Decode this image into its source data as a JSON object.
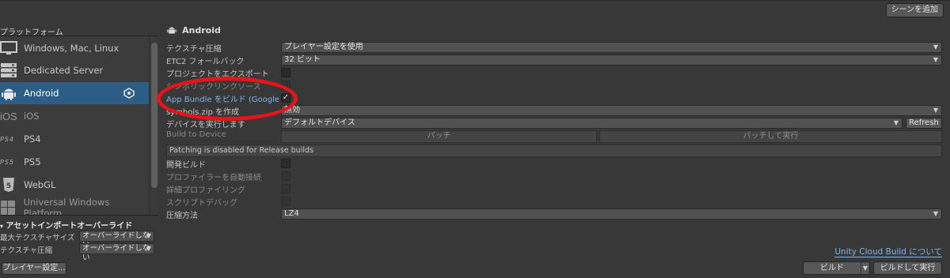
{
  "topbar": {
    "add_scene_label": "シーンを追加"
  },
  "platforms": {
    "header": "プラットフォーム",
    "items": [
      {
        "label": "Windows, Mac, Linux",
        "icon": "monitor-icon",
        "selected": false,
        "dim": false
      },
      {
        "label": "Dedicated Server",
        "icon": "server-icon",
        "selected": false,
        "dim": false
      },
      {
        "label": "Android",
        "icon": "android-icon",
        "selected": true,
        "dim": false
      },
      {
        "label": "iOS",
        "icon": "ios-icon",
        "selected": false,
        "dim": true
      },
      {
        "label": "PS4",
        "icon": "ps4-icon",
        "selected": false,
        "dim": false
      },
      {
        "label": "PS5",
        "icon": "ps5-icon",
        "selected": false,
        "dim": false
      },
      {
        "label": "WebGL",
        "icon": "html5-icon",
        "selected": false,
        "dim": false
      },
      {
        "label": "Universal Windows Platform",
        "icon": "windows-icon",
        "selected": false,
        "dim": true
      }
    ]
  },
  "asset_import": {
    "header": "アセットインポートオーバーライド",
    "rows": [
      {
        "label": "最大テクスチャサイズ",
        "value": "オーバーライドしない"
      },
      {
        "label": "テクスチャ圧縮",
        "value": "オーバーライドしない"
      }
    ]
  },
  "player_settings_label": "プレイヤー設定...",
  "android": {
    "title": "Android",
    "texture_compression": {
      "label": "テクスチャ圧縮",
      "value": "プレイヤー設定を使用"
    },
    "etc2_fallback": {
      "label": "ETC2 フォールバック",
      "value": "32 ビット"
    },
    "export_project": {
      "label": "プロジェクトをエクスポート"
    },
    "symlink_sources": {
      "label": "シンボリックリンクソース"
    },
    "app_bundle": {
      "label": "App Bundle をビルド (Google Play)",
      "checked": true
    },
    "symbols_zip": {
      "label": "symbols.zip を作成",
      "value": "無効"
    },
    "run_device": {
      "label": "デバイスを実行します",
      "value": "デフォルトデバイス",
      "refresh_label": "Refresh"
    },
    "build_to_device": {
      "label": "Build to Device",
      "patch_label": "パッチ",
      "patch_run_label": "パッチして実行"
    },
    "patching_help": "Patching is disabled for Release builds",
    "development_build": {
      "label": "開発ビルド"
    },
    "autoconnect_profiler": {
      "label": "プロファイラーを自動接続"
    },
    "deep_profiling": {
      "label": "詳細プロファイリング"
    },
    "script_debugging": {
      "label": "スクリプトデバッグ"
    },
    "compression": {
      "label": "圧縮方法",
      "value": "LZ4"
    }
  },
  "cloud_build_link": "Unity Cloud Build について",
  "build_buttons": {
    "build_label": "ビルド",
    "build_run_label": "ビルドして実行"
  },
  "colors": {
    "selected_row": "#2c5d87",
    "link": "#7fb4ec",
    "annotation": "#e8131b",
    "panel_bg": "#383838"
  }
}
